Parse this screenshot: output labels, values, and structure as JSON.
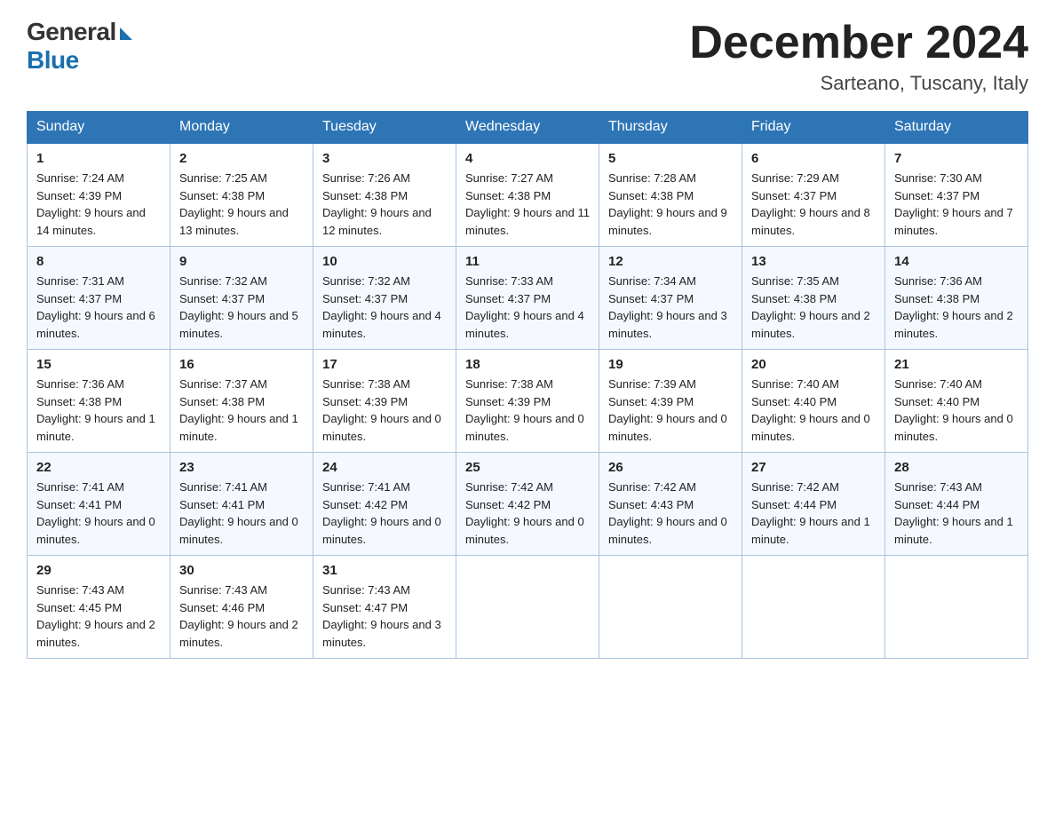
{
  "logo": {
    "general": "General",
    "blue": "Blue"
  },
  "title": "December 2024",
  "location": "Sarteano, Tuscany, Italy",
  "days_of_week": [
    "Sunday",
    "Monday",
    "Tuesday",
    "Wednesday",
    "Thursday",
    "Friday",
    "Saturday"
  ],
  "weeks": [
    [
      {
        "num": "1",
        "sunrise": "7:24 AM",
        "sunset": "4:39 PM",
        "daylight": "9 hours and 14 minutes."
      },
      {
        "num": "2",
        "sunrise": "7:25 AM",
        "sunset": "4:38 PM",
        "daylight": "9 hours and 13 minutes."
      },
      {
        "num": "3",
        "sunrise": "7:26 AM",
        "sunset": "4:38 PM",
        "daylight": "9 hours and 12 minutes."
      },
      {
        "num": "4",
        "sunrise": "7:27 AM",
        "sunset": "4:38 PM",
        "daylight": "9 hours and 11 minutes."
      },
      {
        "num": "5",
        "sunrise": "7:28 AM",
        "sunset": "4:38 PM",
        "daylight": "9 hours and 9 minutes."
      },
      {
        "num": "6",
        "sunrise": "7:29 AM",
        "sunset": "4:37 PM",
        "daylight": "9 hours and 8 minutes."
      },
      {
        "num": "7",
        "sunrise": "7:30 AM",
        "sunset": "4:37 PM",
        "daylight": "9 hours and 7 minutes."
      }
    ],
    [
      {
        "num": "8",
        "sunrise": "7:31 AM",
        "sunset": "4:37 PM",
        "daylight": "9 hours and 6 minutes."
      },
      {
        "num": "9",
        "sunrise": "7:32 AM",
        "sunset": "4:37 PM",
        "daylight": "9 hours and 5 minutes."
      },
      {
        "num": "10",
        "sunrise": "7:32 AM",
        "sunset": "4:37 PM",
        "daylight": "9 hours and 4 minutes."
      },
      {
        "num": "11",
        "sunrise": "7:33 AM",
        "sunset": "4:37 PM",
        "daylight": "9 hours and 4 minutes."
      },
      {
        "num": "12",
        "sunrise": "7:34 AM",
        "sunset": "4:37 PM",
        "daylight": "9 hours and 3 minutes."
      },
      {
        "num": "13",
        "sunrise": "7:35 AM",
        "sunset": "4:38 PM",
        "daylight": "9 hours and 2 minutes."
      },
      {
        "num": "14",
        "sunrise": "7:36 AM",
        "sunset": "4:38 PM",
        "daylight": "9 hours and 2 minutes."
      }
    ],
    [
      {
        "num": "15",
        "sunrise": "7:36 AM",
        "sunset": "4:38 PM",
        "daylight": "9 hours and 1 minute."
      },
      {
        "num": "16",
        "sunrise": "7:37 AM",
        "sunset": "4:38 PM",
        "daylight": "9 hours and 1 minute."
      },
      {
        "num": "17",
        "sunrise": "7:38 AM",
        "sunset": "4:39 PM",
        "daylight": "9 hours and 0 minutes."
      },
      {
        "num": "18",
        "sunrise": "7:38 AM",
        "sunset": "4:39 PM",
        "daylight": "9 hours and 0 minutes."
      },
      {
        "num": "19",
        "sunrise": "7:39 AM",
        "sunset": "4:39 PM",
        "daylight": "9 hours and 0 minutes."
      },
      {
        "num": "20",
        "sunrise": "7:40 AM",
        "sunset": "4:40 PM",
        "daylight": "9 hours and 0 minutes."
      },
      {
        "num": "21",
        "sunrise": "7:40 AM",
        "sunset": "4:40 PM",
        "daylight": "9 hours and 0 minutes."
      }
    ],
    [
      {
        "num": "22",
        "sunrise": "7:41 AM",
        "sunset": "4:41 PM",
        "daylight": "9 hours and 0 minutes."
      },
      {
        "num": "23",
        "sunrise": "7:41 AM",
        "sunset": "4:41 PM",
        "daylight": "9 hours and 0 minutes."
      },
      {
        "num": "24",
        "sunrise": "7:41 AM",
        "sunset": "4:42 PM",
        "daylight": "9 hours and 0 minutes."
      },
      {
        "num": "25",
        "sunrise": "7:42 AM",
        "sunset": "4:42 PM",
        "daylight": "9 hours and 0 minutes."
      },
      {
        "num": "26",
        "sunrise": "7:42 AM",
        "sunset": "4:43 PM",
        "daylight": "9 hours and 0 minutes."
      },
      {
        "num": "27",
        "sunrise": "7:42 AM",
        "sunset": "4:44 PM",
        "daylight": "9 hours and 1 minute."
      },
      {
        "num": "28",
        "sunrise": "7:43 AM",
        "sunset": "4:44 PM",
        "daylight": "9 hours and 1 minute."
      }
    ],
    [
      {
        "num": "29",
        "sunrise": "7:43 AM",
        "sunset": "4:45 PM",
        "daylight": "9 hours and 2 minutes."
      },
      {
        "num": "30",
        "sunrise": "7:43 AM",
        "sunset": "4:46 PM",
        "daylight": "9 hours and 2 minutes."
      },
      {
        "num": "31",
        "sunrise": "7:43 AM",
        "sunset": "4:47 PM",
        "daylight": "9 hours and 3 minutes."
      },
      null,
      null,
      null,
      null
    ]
  ],
  "labels": {
    "sunrise": "Sunrise:",
    "sunset": "Sunset:",
    "daylight": "Daylight:"
  }
}
